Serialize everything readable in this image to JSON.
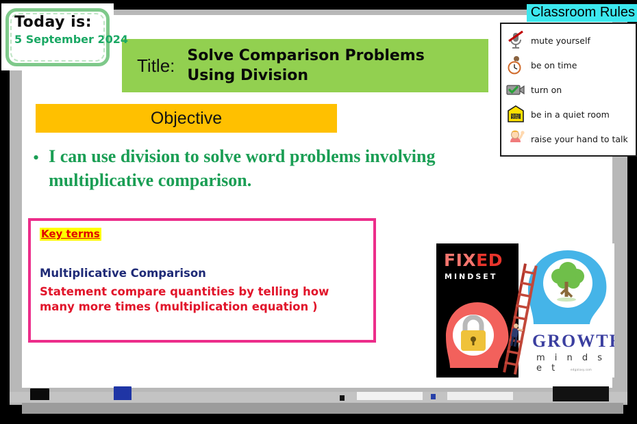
{
  "today_card": {
    "heading": "Today  is:",
    "date": "5 September 2024"
  },
  "classroom_rules": {
    "heading": "Classroom Rules",
    "items": [
      {
        "icon": "muted-microphone-icon",
        "label": "mute yourself"
      },
      {
        "icon": "clock-person-icon",
        "label": "be on time"
      },
      {
        "icon": "video-camera-check-icon",
        "label": "turn on"
      },
      {
        "icon": "quiet-zone-sign-icon",
        "label": "be in a quiet room"
      },
      {
        "icon": "raise-hand-person-icon",
        "label": "raise your hand to talk"
      }
    ]
  },
  "title_bar": {
    "label": "Title:",
    "line1": "Solve Comparison Problems",
    "line2": "Using Division",
    "background": "#92d050"
  },
  "objective": {
    "banner": "Objective",
    "banner_background": "#ffc000",
    "bullet": "•",
    "text": "I can use division  to solve word problems involving multiplicative comparison.",
    "text_color": "#1a9e54"
  },
  "key_terms": {
    "heading": "Key terms",
    "heading_highlight": "#ffff00",
    "heading_color": "#e00000",
    "border_color": "#ec2d8a",
    "term": "Multiplicative Comparison",
    "term_color": "#1f2b77",
    "definition": "Statement compare quantities by telling how many more times  (multiplication equation )",
    "definition_color": "#e1142a"
  },
  "mindset_image": {
    "fixed_word_part1": "FIX",
    "fixed_word_part2": "ED",
    "fixed_subtitle": "MINDSET",
    "growth_word": "GROWTH",
    "growth_subtitle": "m i n d s e t",
    "credit": "edgalaxy.com",
    "elements": [
      "padlock-head-icon",
      "tree-head-icon",
      "ladder-climber-icon"
    ]
  },
  "whiteboard": {
    "frame_color": "#b8b8b8",
    "tray_color": "#9c9c9c",
    "tray_items": [
      "eraser",
      "blue-marker",
      "black-marker",
      "white-eraser",
      "blue-marker",
      "white-eraser",
      "eraser"
    ]
  }
}
